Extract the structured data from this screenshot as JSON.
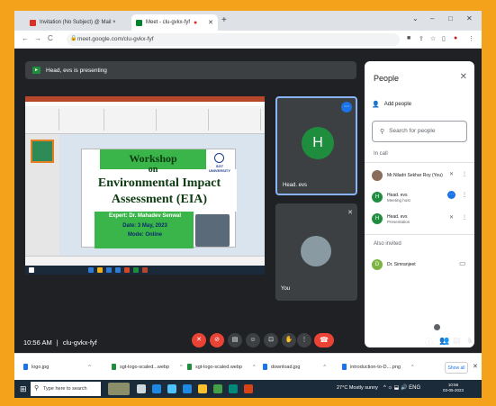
{
  "browser": {
    "tabs": [
      {
        "label": "Invitation (No Subject) @ Mail ×",
        "active": false
      },
      {
        "label": "Meet - clu-gvkx-fyf",
        "active": true
      }
    ],
    "new_tab": "+",
    "url": "meet.google.com/clu-gvkx-fyf",
    "window_controls": [
      "⌄",
      "–",
      "□",
      "✕"
    ]
  },
  "meet": {
    "presenting_text": "Head, evs is presenting",
    "tiles": [
      {
        "initial": "H",
        "name": "Head. evs"
      },
      {
        "name": "You"
      }
    ],
    "time": "10:56 AM",
    "separator": "|",
    "meeting_code": "clu-gvkx-fyf"
  },
  "slide": {
    "line1": "Workshop",
    "line2": "on",
    "line3": "Environmental Impact",
    "line4": "Assessment (EIA)",
    "expert": "Expert: Dr. Mahadev Senwal",
    "date": "Date: 3 May, 2023",
    "mode": "Mode: Online",
    "logo_text": "SGT UNIVERSITY"
  },
  "people": {
    "title": "People",
    "add_label": "Add people",
    "search_placeholder": "Search for people",
    "in_call_label": "In call",
    "in_call": [
      {
        "name": "Mr.Niladri Sekhar Roy (You)",
        "sub": "",
        "color": "#8a6d5a"
      },
      {
        "name": "Head. evs",
        "sub": "Meeting host",
        "initial": "H",
        "color": "#1e8e3e"
      },
      {
        "name": "Head. evs",
        "sub": "Presentation",
        "initial": "H",
        "color": "#1e8e3e"
      }
    ],
    "also_invited_label": "Also invited",
    "invited": [
      {
        "name": "Dr. Simranjeet",
        "initial": "D",
        "color": "#7cb342"
      }
    ]
  },
  "downloads": {
    "items": [
      "logo.jpg",
      "sgt-logo-scaled...webp",
      "sgt-logo-scaled.webp",
      "download.jpg",
      "introduction-to-D....png"
    ],
    "show_all": "Show all"
  },
  "taskbar": {
    "search_placeholder": "Type here to search",
    "weather": "27°C  Mostly sunny",
    "tray": "^ ☼ ⬓ 🔊 ENG",
    "time": "10:56",
    "date": "03-05-2023"
  },
  "colors": {
    "meet_bg": "#202124",
    "accent": "#1a73e8",
    "end_call": "#ea4335",
    "slide_green": "#39b54a"
  }
}
